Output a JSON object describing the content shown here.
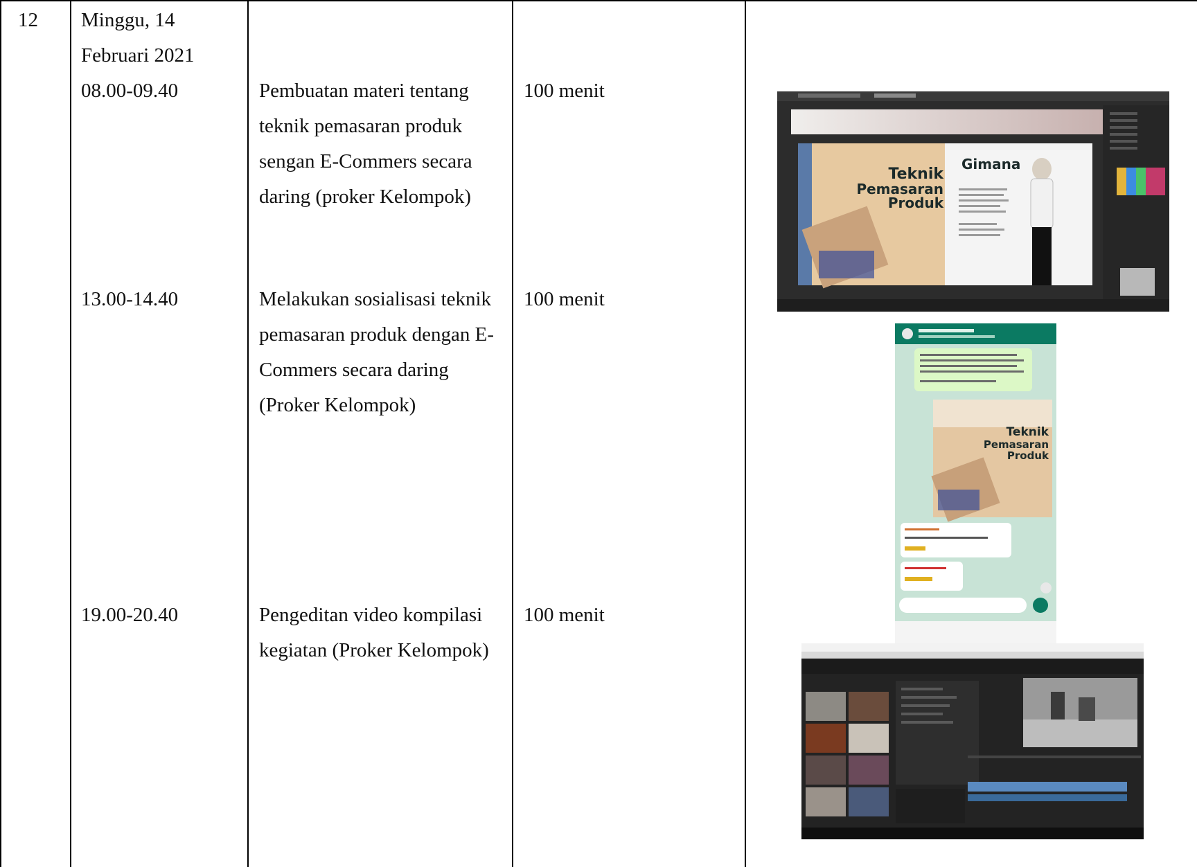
{
  "row": {
    "number": "12",
    "day": "Minggu, 14",
    "date": "Februari 2021"
  },
  "activities": [
    {
      "time": "08.00-09.40",
      "description": [
        "Pembuatan materi tentang",
        "teknik pemasaran produk",
        "sengan E-Commers secara",
        "daring (proker Kelompok)"
      ],
      "duration": "100 menit"
    },
    {
      "time": "13.00-14.40",
      "description": [
        "Melakukan sosialisasi teknik",
        "pemasaran produk dengan E-",
        "Commers secara daring",
        "(Proker Kelompok)"
      ],
      "duration": "100 menit"
    },
    {
      "time": "19.00-20.40",
      "description": [
        "Pengeditan video kompilasi",
        "kegiatan (Proker Kelompok)"
      ],
      "duration": "100 menit"
    }
  ],
  "screenshots": {
    "design": {
      "title_line1": "Teknik",
      "title_line2": "Pemasaran",
      "title_line3": "Produk",
      "side_title": "Gimana"
    },
    "chat": {
      "title_line1": "Teknik",
      "title_line2": "Pemasaran",
      "title_line3": "Produk"
    }
  },
  "colors": {
    "border": "#000000",
    "editor_dark": "#2b2b2b",
    "chat_bg": "#cfe6dc",
    "chat_header": "#0b7a62"
  }
}
